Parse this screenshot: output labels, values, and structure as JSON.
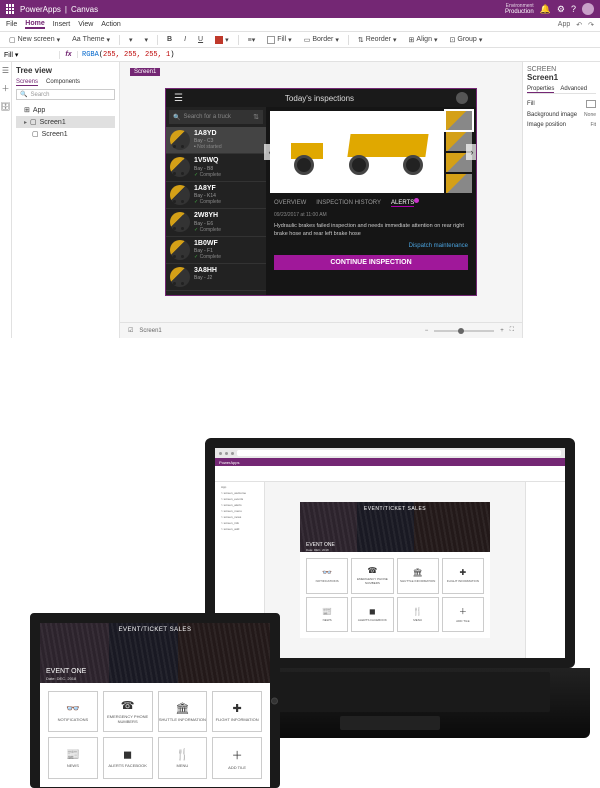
{
  "titlebar": {
    "appname": "PowerApps",
    "filename": "Canvas",
    "env_label": "Environment",
    "env_value": "Production"
  },
  "ribbon": {
    "tabs": [
      "File",
      "Home",
      "Insert",
      "View",
      "Action"
    ],
    "active": "Home",
    "undo_icon": "↶",
    "redo_icon": "↷",
    "new_screen": "New screen",
    "theme": "Theme",
    "fill": "Fill",
    "border": "Border",
    "reorder": "Reorder",
    "align": "Align",
    "group": "Group",
    "right": [
      "App"
    ]
  },
  "fx": {
    "property": "Fill",
    "fn": "RGBA",
    "args": "255, 255, 255, 1"
  },
  "tree": {
    "title": "Tree view",
    "subtabs": [
      "Screens",
      "Components"
    ],
    "search_placeholder": "Search",
    "app_node": "App",
    "screen_node": "Screen1"
  },
  "canvas": {
    "selection": "Screen1"
  },
  "app": {
    "title": "Today's inspections",
    "search_placeholder": "Search for a truck",
    "trucks": [
      {
        "id": "1A8YD",
        "bay": "Bay - C3",
        "status": "Not started",
        "cls": "pend"
      },
      {
        "id": "1V5WQ",
        "bay": "Bay - B8",
        "status": "Complete",
        "cls": "done"
      },
      {
        "id": "1A8YF",
        "bay": "Bay - K14",
        "status": "Complete",
        "cls": "done"
      },
      {
        "id": "2W8YH",
        "bay": "Bay - E6",
        "status": "Complete",
        "cls": "done"
      },
      {
        "id": "1B0WF",
        "bay": "Bay - F1",
        "status": "Complete",
        "cls": "done"
      },
      {
        "id": "3A8HH",
        "bay": "Bay - J2",
        "status": "",
        "cls": ""
      }
    ],
    "detail_tabs": [
      "OVERVIEW",
      "INSPECTION HISTORY",
      "ALERTS"
    ],
    "detail_date": "09/23/2017 at 11:00 AM",
    "detail_text": "Hydraulic brakes failed inspection and needs immediate attention on rear right brake hose and rear left brake hose",
    "dispatch": "Dispatch maintenance",
    "continue": "CONTINUE INSPECTION"
  },
  "props": {
    "hdr": "SCREEN",
    "name": "Screen1",
    "tabs": [
      "Properties",
      "Advanced"
    ],
    "rows": [
      {
        "label": "Fill",
        "val": ""
      },
      {
        "label": "Background image",
        "val": "None"
      },
      {
        "label": "Image position",
        "val": "Fit"
      }
    ]
  },
  "event_app": {
    "hero_title": "EVENT/TICKET SALES",
    "event_name": "EVENT ONE",
    "event_date": "Date: DEC. 2018",
    "tiles": [
      {
        "icon": "👓",
        "label": "NOTIFICATIONS",
        "accent": true
      },
      {
        "icon": "☎",
        "label": "EMERGENCY PHONE NUMBERS"
      },
      {
        "icon": "🏛",
        "label": "SHUTTLE INFORMATION"
      },
      {
        "icon": "✚",
        "label": "FLIGHT INFORMATION"
      },
      {
        "icon": "📰",
        "label": "NEWS"
      },
      {
        "icon": "◼",
        "label": "ALERTS FACEBOOK"
      },
      {
        "icon": "🍴",
        "label": "MENU"
      },
      {
        "icon": "＋",
        "label": "ADD TILE"
      }
    ]
  },
  "laptop_tree": [
    "App",
    "> screen_welcome",
    "> screen_events",
    "> screen_alerts",
    "> screen_menu",
    "> screen_news",
    "> screen_info",
    "> screen_add"
  ]
}
